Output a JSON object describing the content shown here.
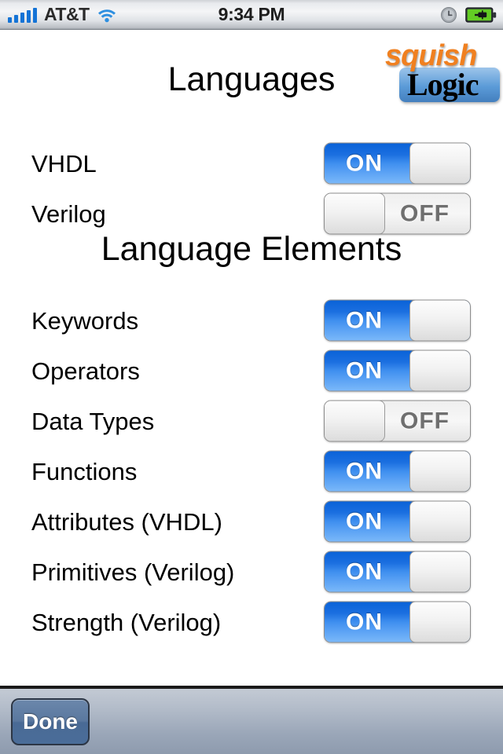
{
  "status_bar": {
    "carrier": "AT&T",
    "time": "9:34 PM",
    "signal_bars": 5,
    "signal_icon": "signal-bars-icon",
    "wifi_icon": "wifi-icon",
    "alarm_icon": "alarm-clock-icon",
    "battery_icon": "battery-charging-icon",
    "accent_blue": "#1473d6",
    "battery_green": "#5ec62a"
  },
  "logo": {
    "word_top": "squish",
    "word_bottom": "Logic",
    "top_color": "#F08020",
    "bottom_color": "#000000",
    "plate_color": "#5b9bd8"
  },
  "sections": [
    {
      "title": "Languages",
      "rows": [
        {
          "label": "VHDL",
          "state": "ON",
          "state_label": "ON"
        },
        {
          "label": "Verilog",
          "state": "OFF",
          "state_label": "OFF"
        }
      ]
    },
    {
      "title": "Language Elements",
      "rows": [
        {
          "label": "Keywords",
          "state": "ON",
          "state_label": "ON"
        },
        {
          "label": "Operators",
          "state": "ON",
          "state_label": "ON"
        },
        {
          "label": "Data Types",
          "state": "OFF",
          "state_label": "OFF"
        },
        {
          "label": "Functions",
          "state": "ON",
          "state_label": "ON"
        },
        {
          "label": "Attributes (VHDL)",
          "state": "ON",
          "state_label": "ON"
        },
        {
          "label": "Primitives (Verilog)",
          "state": "ON",
          "state_label": "ON"
        },
        {
          "label": "Strength (Verilog)",
          "state": "ON",
          "state_label": "ON"
        }
      ]
    }
  ],
  "toolbar": {
    "done_label": "Done",
    "button_color": "#4f719b"
  }
}
